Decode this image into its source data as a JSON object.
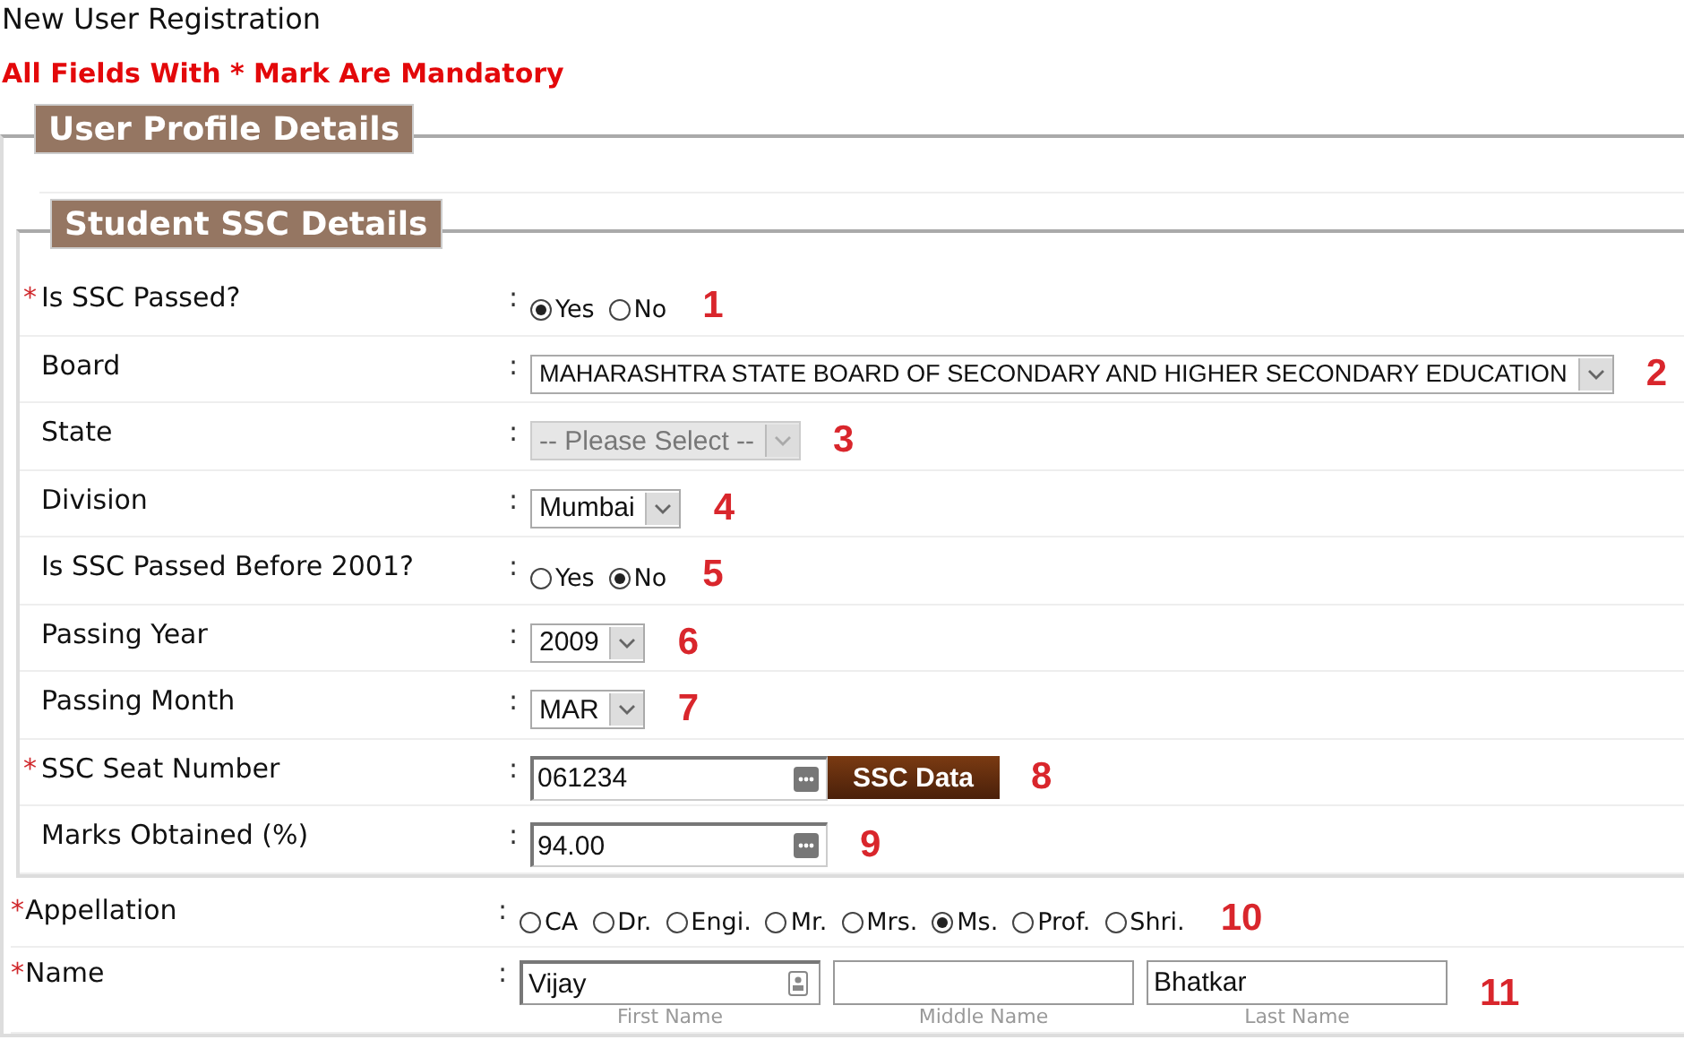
{
  "page_title": "New User Registration",
  "mandatory_note": "All Fields With * Mark Are Mandatory",
  "profile_section": {
    "legend": "User Profile Details",
    "ssc_section": {
      "legend": "Student SSC Details",
      "rows": [
        {
          "kind": "radio",
          "mark": "*",
          "label": "Is SSC Passed?",
          "separator": ":",
          "options": [
            {
              "label": "Yes",
              "selected": true
            },
            {
              "label": "No",
              "selected": false
            }
          ],
          "annotation": "1"
        },
        {
          "kind": "select",
          "label": "Board",
          "separator": ":",
          "value": "MAHARASHTRA STATE BOARD OF SECONDARY AND HIGHER SECONDARY EDUCATION",
          "disabled": false,
          "annotation": "2"
        },
        {
          "kind": "select",
          "label": "State",
          "separator": ":",
          "value": "-- Please Select --",
          "disabled": true,
          "annotation": "3"
        },
        {
          "kind": "select",
          "label": "Division",
          "separator": ":",
          "value": "Mumbai",
          "disabled": false,
          "annotation": "4"
        },
        {
          "kind": "radio",
          "label": "Is SSC Passed Before 2001?",
          "separator": ":",
          "options": [
            {
              "label": "Yes",
              "selected": false
            },
            {
              "label": "No",
              "selected": true
            }
          ],
          "annotation": "5"
        },
        {
          "kind": "select",
          "label": "Passing Year",
          "separator": ":",
          "value": "2009",
          "disabled": false,
          "annotation": "6"
        },
        {
          "kind": "select",
          "label": "Passing Month",
          "separator": ":",
          "value": "MAR",
          "disabled": false,
          "annotation": "7"
        },
        {
          "kind": "text",
          "mark": "*",
          "label": "SSC Seat Number",
          "separator": ":",
          "value": "061234",
          "button": "SSC Data",
          "annotation": "8"
        },
        {
          "kind": "text",
          "label": "Marks Obtained (%)",
          "separator": ":",
          "value": "94.00",
          "annotation": "9"
        }
      ]
    },
    "rows": [
      {
        "kind": "radio",
        "mark": "*",
        "label": "Appellation",
        "separator": ":",
        "options": [
          {
            "label": "CA",
            "selected": false
          },
          {
            "label": "Dr.",
            "selected": false
          },
          {
            "label": "Engi.",
            "selected": false
          },
          {
            "label": "Mr.",
            "selected": false
          },
          {
            "label": "Mrs.",
            "selected": false
          },
          {
            "label": "Ms.",
            "selected": true
          },
          {
            "label": "Prof.",
            "selected": false
          },
          {
            "label": "Shri.",
            "selected": false
          }
        ],
        "annotation": "10"
      },
      {
        "kind": "name",
        "mark": "*",
        "label": "Name",
        "separator": ":",
        "fields": [
          {
            "value": "Vijay",
            "caption": "First Name"
          },
          {
            "caption": "Middle Name"
          },
          {
            "value": "Bhatkar",
            "caption": "Last Name"
          }
        ],
        "annotation": "11"
      }
    ]
  }
}
